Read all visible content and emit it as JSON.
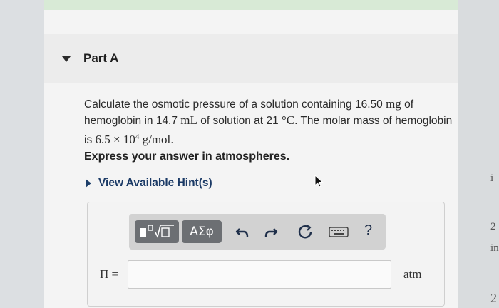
{
  "part": {
    "title": "Part A"
  },
  "question": {
    "seg1": "Calculate the osmotic pressure of a solution containing 16.50 ",
    "mass_unit": "mg",
    "seg2": " of hemoglobin in 14.7 ",
    "vol_unit": "mL",
    "seg3": " of solution at 21 ",
    "temp_unit": "°C",
    "seg4": ". The molar mass of hemoglobin is ",
    "molar_mass_base": "6.5 × 10",
    "molar_mass_exp": "4",
    "molar_mass_unit": " g/mol",
    "seg5": "."
  },
  "instruction": "Express your answer in atmospheres.",
  "hint": {
    "label": "View Available Hint(s)"
  },
  "toolbar": {
    "greek_label": "ΑΣφ",
    "help_label": "?",
    "icons": [
      "templates-icon",
      "undo-icon",
      "redo-icon",
      "reset-icon",
      "keyboard-icon",
      "help-icon"
    ]
  },
  "answer": {
    "variable": "Π =",
    "value": "",
    "unit": "atm"
  },
  "right_edge": {
    "t1": "i",
    "t2": "2",
    "t3": "in",
    "t4": "2"
  }
}
